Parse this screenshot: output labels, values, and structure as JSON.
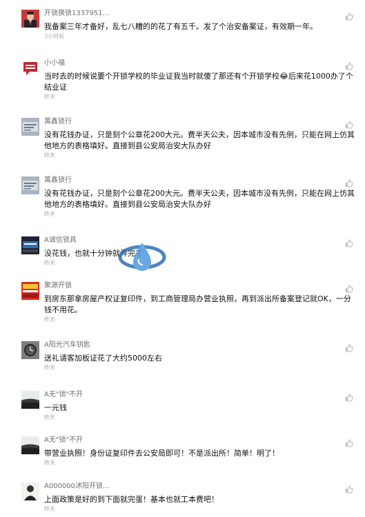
{
  "comments": [
    {
      "user": "开锁换锁1337951...",
      "text": "我备案三年才备好，乱七八糟的的花了有五千。发了个治安备案证，有效期一年。",
      "time": "3小时前",
      "avatar": "man-in-suit-avatar"
    },
    {
      "user": "小小福",
      "text": "当时去的时候说要个开锁学校的毕业证我当时就傻了那还有个开锁学校😂后来花1000办了个结业证",
      "time": "昨天",
      "avatar": "red-speech-bubble-avatar"
    },
    {
      "user": "萬鑫锁行",
      "text": "没有花钱办证，只是刻个公章花200大元。费半天公夫，因本城市没有先例，只能在网上仿其他地方的表格填好。直接到县公安局治安大队办好",
      "time": "昨天",
      "avatar": "shop-sign-avatar"
    },
    {
      "user": "萬鑫锁行",
      "text": "没有花钱办证，只是刻个公章花200大元。费半天公夫，因本城市没有先例，只能在网上仿其他地方的表格填好。直接到县公安局治安大队办好",
      "time": "昨天",
      "avatar": "shop-sign-avatar"
    },
    {
      "user": "A诚信锁具",
      "text": "没花钱，也就十分钟就弄完了",
      "time": "昨天",
      "avatar": "dark-shop-sign-avatar"
    },
    {
      "user": "聚源开锁",
      "text": "到房东那拿房屋产权证复印件，到工商管理局办营业执照，再到派出所备案登记就OK，一分钱不用花。",
      "time": "昨天",
      "avatar": "red-banner-avatar"
    },
    {
      "user": "A阳光汽车钥匙",
      "text": "送礼请客加板证花了大约5000左右",
      "time": "昨天",
      "avatar": "watch-avatar"
    },
    {
      "user": "A无\"锁\"不开",
      "text": "一元钱",
      "time": "昨天",
      "avatar": "landscape-avatar"
    },
    {
      "user": "A无\"锁\"不开",
      "text": "带营业执照！身份证复印件去公安局即可！不是派出所！简单！明了！",
      "time": "昨天",
      "avatar": "landscape-avatar"
    },
    {
      "user": "A000000沭阳开锁...",
      "text": "上面政策是好的到下面就完蛋！基本也就工本费吧！",
      "time": "昨天",
      "avatar": "person-portrait-avatar"
    }
  ],
  "like_icon": "thumbs-up-icon",
  "watermark_icon": "water-drop-logo-icon",
  "colors": {
    "username": "#6f6f6f",
    "text": "#111111",
    "time": "#aaaaaa",
    "like": "#b7b7b7"
  }
}
